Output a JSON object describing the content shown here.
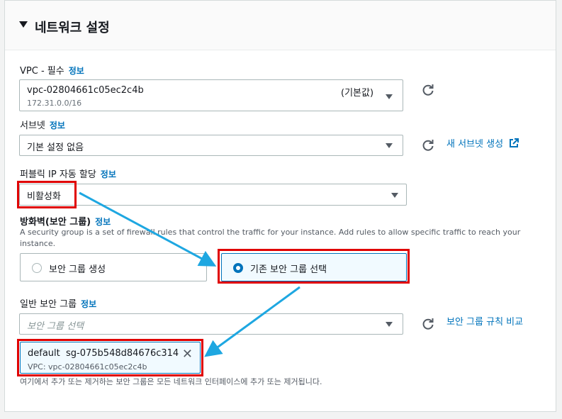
{
  "panel": {
    "title": "네트워크 설정"
  },
  "vpc": {
    "label": "VPC - 필수",
    "info": "정보",
    "value": "vpc-02804661c05ec2c4b",
    "tag": "(기본값)",
    "cidr": "172.31.0.0/16"
  },
  "subnet": {
    "label": "서브넷",
    "info": "정보",
    "value": "기본 설정 없음",
    "create_link": "새 서브넷 생성"
  },
  "public_ip": {
    "label": "퍼블릭 IP 자동 할당",
    "info": "정보",
    "value": "비활성화"
  },
  "firewall": {
    "label": "방화벽(보안 그룹)",
    "info": "정보",
    "description": "A security group is a set of firewall rules that control the traffic for your instance. Add rules to allow specific traffic to reach your instance.",
    "option_create": "보안 그룹 생성",
    "option_existing": "기존 보안 그룹 선택",
    "selected_option": "existing"
  },
  "common_sg": {
    "label": "일반 보안 그룹",
    "info": "정보",
    "placeholder": "보안 그룹 선택",
    "compare_link": "보안 그룹 규칙 비교",
    "selected": {
      "name": "default",
      "id": "sg-075b548d84676c314",
      "vpc": "VPC: vpc-02804661c05ec2c4b"
    },
    "help_text": "여기에서 추가 또는 제거하는 보안 그룹은 모든 네트워크 인터페이스에 추가 또는 제거됩니다."
  },
  "colors": {
    "accent": "#0073bb",
    "highlight": "#e00000",
    "arrow": "#1ea7e1"
  }
}
